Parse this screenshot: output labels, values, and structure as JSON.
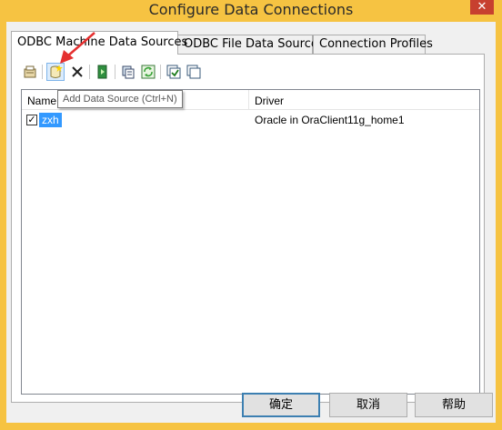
{
  "window": {
    "title": "Configure Data Connections",
    "close_glyph": "✕",
    "accent_color": "#f6c342"
  },
  "tabs": [
    {
      "label": "ODBC Machine Data Sources",
      "active": true
    },
    {
      "label": "ODBC File Data Sources",
      "active": false
    },
    {
      "label": "Connection Profiles",
      "active": false
    }
  ],
  "toolbar": {
    "buttons": [
      {
        "icon": "properties-icon"
      },
      {
        "icon": "add-data-source-icon",
        "hovered": true
      },
      {
        "icon": "delete-icon"
      },
      {
        "icon": "run-icon"
      },
      {
        "icon": "copy-icon"
      },
      {
        "icon": "refresh-icon"
      },
      {
        "icon": "check-all-icon"
      },
      {
        "icon": "uncheck-all-icon"
      }
    ],
    "tooltip": "Add Data Source (Ctrl+N)"
  },
  "list": {
    "columns": [
      "Name",
      "Driver"
    ],
    "rows": [
      {
        "checked": true,
        "name": "zxh",
        "driver": "Oracle in OraClient11g_home1"
      }
    ]
  },
  "buttons": {
    "ok": "确定",
    "cancel": "取消",
    "help": "帮助"
  },
  "colors": {
    "selection": "#3399ff",
    "annotation_arrow": "#e53030"
  }
}
